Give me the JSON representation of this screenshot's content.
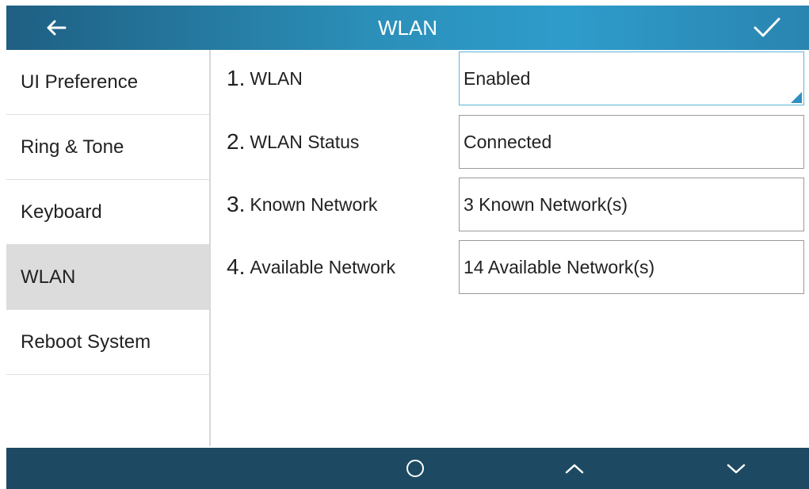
{
  "header": {
    "title": "WLAN",
    "back_icon": "arrow-left-icon",
    "confirm_icon": "checkmark-icon"
  },
  "sidebar": {
    "items": [
      {
        "label": "UI Preference",
        "active": false
      },
      {
        "label": "Ring & Tone",
        "active": false
      },
      {
        "label": "Keyboard",
        "active": false
      },
      {
        "label": "WLAN",
        "active": true
      },
      {
        "label": "Reboot System",
        "active": false
      }
    ]
  },
  "settings": [
    {
      "num": "1.",
      "label": "WLAN",
      "value": "Enabled",
      "dropdown": true
    },
    {
      "num": "2.",
      "label": "WLAN Status",
      "value": "Connected",
      "dropdown": false
    },
    {
      "num": "3.",
      "label": "Known Network",
      "value": "3 Known Network(s)",
      "dropdown": false
    },
    {
      "num": "4.",
      "label": "Available Network",
      "value": "14 Available Network(s)",
      "dropdown": false
    }
  ],
  "softkeys": [
    "circle-icon",
    "chevron-up-icon",
    "chevron-down-icon"
  ],
  "colors": {
    "titlebar": "#2b8fb8",
    "bottombar": "#1d4a62",
    "active_item": "#dcdcdc",
    "focus_border": "#5cb6d8"
  }
}
